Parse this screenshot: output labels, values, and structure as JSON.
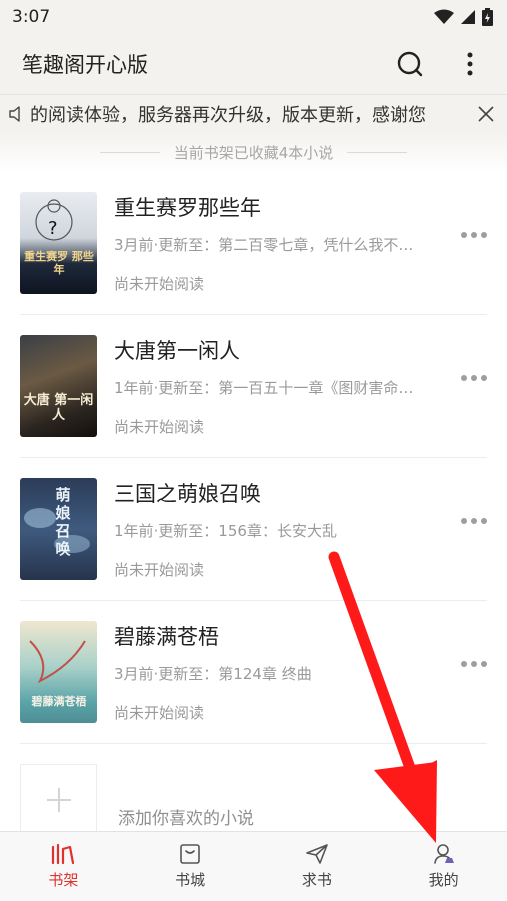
{
  "status_bar": {
    "time": "3:07"
  },
  "app_bar": {
    "title": "笔趣阁开心版"
  },
  "notice": {
    "text": "的阅读体验，服务器再次升级，版本更新，感谢您"
  },
  "shelf": {
    "summary": "当前书架已收藏4本小说"
  },
  "books": [
    {
      "title": "重生赛罗那些年",
      "update": "3月前·更新至：第二百零七章，凭什么我不…",
      "status": "尚未开始阅读",
      "cover_text": "重生赛罗 那些年"
    },
    {
      "title": "大唐第一闲人",
      "update": "1年前·更新至：第一百五十一章《图财害命…",
      "status": "尚未开始阅读",
      "cover_text": "大唐 第一闲人"
    },
    {
      "title": "三国之萌娘召唤",
      "update": "1年前·更新至：156章：长安大乱",
      "status": "尚未开始阅读",
      "cover_text": "萌 娘 召唤"
    },
    {
      "title": "碧藤满苍梧",
      "update": "3月前·更新至：第124章 终曲",
      "status": "尚未开始阅读",
      "cover_text": "碧藤满苍梧"
    }
  ],
  "add_book": {
    "label": "添加你喜欢的小说"
  },
  "bottom_nav": [
    {
      "label": "书架",
      "icon": "bookshelf-icon",
      "active": true
    },
    {
      "label": "书城",
      "icon": "bookstore-icon",
      "active": false
    },
    {
      "label": "求书",
      "icon": "paper-plane-icon",
      "active": false
    },
    {
      "label": "我的",
      "icon": "profile-icon",
      "active": false
    }
  ],
  "colors": {
    "accent": "#e0312f",
    "background": "#f4f2ef",
    "annotation": "#ff1a1a"
  }
}
